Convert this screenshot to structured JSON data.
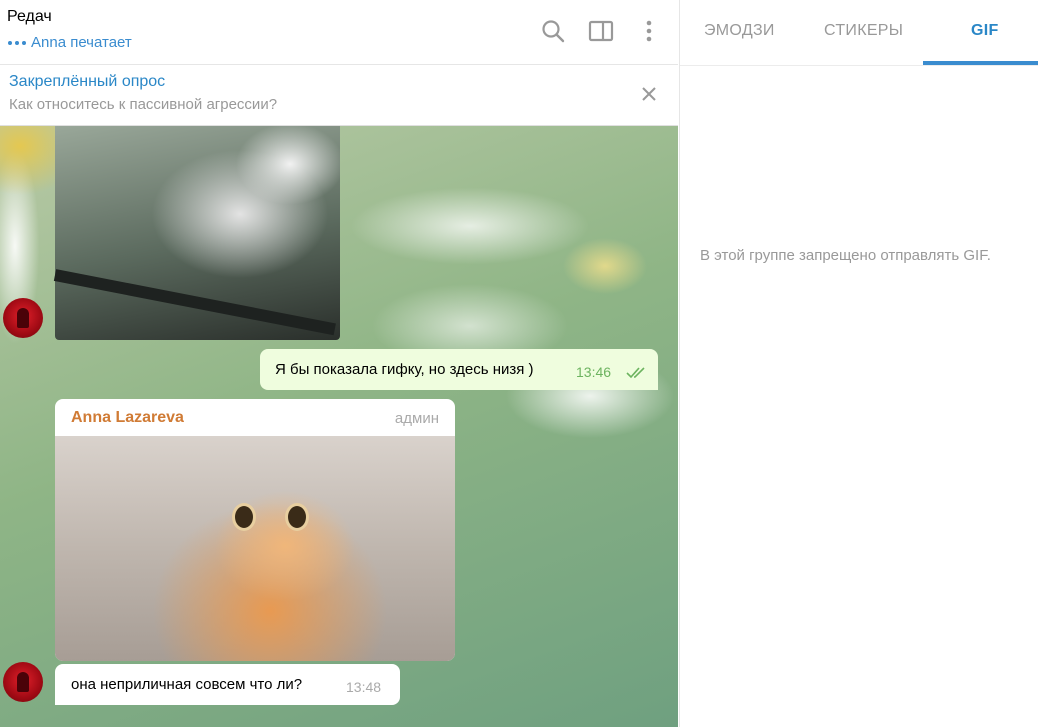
{
  "chat": {
    "title": "Редач",
    "typing_text": "Anna печатает"
  },
  "pinned": {
    "title": "Закреплённый опрос",
    "text": "Как относитесь к пассивной агрессии?"
  },
  "messages": [
    {
      "type": "outgoing",
      "text": "Я бы показала гифку, но здесь низя )",
      "time": "13:46",
      "status": "read"
    },
    {
      "type": "incoming",
      "sender": "Anna Lazareva",
      "role": "админ"
    },
    {
      "type": "incoming",
      "text": "она неприличная совсем что ли?",
      "time": "13:48"
    }
  ],
  "panel": {
    "tabs": [
      {
        "label": "ЭМОДЗИ",
        "active": false
      },
      {
        "label": "СТИКЕРЫ",
        "active": false
      },
      {
        "label": "GIF",
        "active": true
      }
    ],
    "notice": "В этой группе запрещено отправлять GIF."
  },
  "colors": {
    "accent": "#3a8ccf",
    "sender_name": "#d07b35",
    "outgoing_bubble": "#effdde",
    "outgoing_time": "#6cb35f"
  },
  "icons": [
    "search-icon",
    "sidebar-toggle-icon",
    "more-vertical-icon",
    "close-icon",
    "double-check-icon"
  ]
}
